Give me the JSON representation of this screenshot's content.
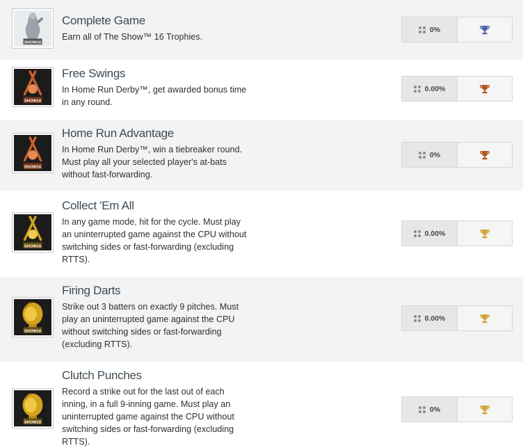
{
  "trophies": [
    {
      "title": "Complete Game",
      "lines": [
        "Earn all of The Show™ 16 Trophies."
      ],
      "percent": "0%",
      "grade": "platinum",
      "trophy_color": "#4e66a3",
      "icon": "platinum-statue-icon",
      "badge_text": "SHOW16"
    },
    {
      "title": "Free Swings",
      "lines": [
        "In Home Run Derby™, get awarded bonus time",
        "in any round."
      ],
      "percent": "0.00%",
      "grade": "bronze",
      "trophy_color": "#b4571e",
      "icon": "bronze-bats-icon",
      "badge_text": "SHOW16"
    },
    {
      "title": "Home Run Advantage",
      "lines": [
        "In Home Run Derby™, win a tiebreaker round.",
        "Must play all your selected player's at-bats",
        "without fast-forwarding."
      ],
      "percent": "0%",
      "grade": "bronze",
      "trophy_color": "#b4571e",
      "icon": "bronze-bats-icon",
      "badge_text": "SHOW16"
    },
    {
      "title": "Collect 'Em All",
      "lines": [
        "In any game mode, hit for the cycle. Must play",
        "an uninterrupted game against the CPU without",
        "switching sides or fast-forwarding (excluding",
        "RTTS)."
      ],
      "percent": "0.00%",
      "grade": "gold",
      "trophy_color": "#d2a536",
      "icon": "gold-bats-icon",
      "badge_text": "SHOW16"
    },
    {
      "title": "Firing Darts",
      "lines": [
        "Strike out 3 batters on exactly 9 pitches. Must",
        "play an uninterrupted game against the CPU",
        "without switching sides or fast-forwarding",
        "(excluding RTTS)."
      ],
      "percent": "0.00%",
      "grade": "gold",
      "trophy_color": "#d2a536",
      "icon": "gold-glove-icon",
      "badge_text": "SHOW16"
    },
    {
      "title": "Clutch Punches",
      "lines": [
        "Record a strike out for the last out of each",
        "inning, in a full 9-inning game. Must play an",
        "uninterrupted game against the CPU without",
        "switching sides or fast-forwarding (excluding",
        "RTTS)."
      ],
      "percent": "0%",
      "grade": "gold",
      "trophy_color": "#d2a536",
      "icon": "gold-glove-icon",
      "badge_text": "SHOW16"
    }
  ]
}
